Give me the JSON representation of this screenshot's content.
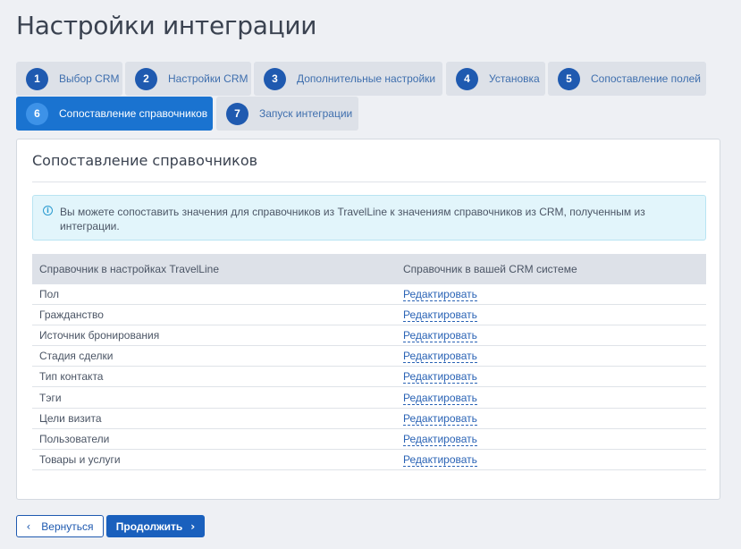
{
  "page": {
    "title": "Настройки интеграции"
  },
  "steps": [
    {
      "num": "1",
      "label": "Выбор CRM",
      "active": false
    },
    {
      "num": "2",
      "label": "Настройки CRM",
      "active": false
    },
    {
      "num": "3",
      "label": "Дополнительные настройки",
      "active": false
    },
    {
      "num": "4",
      "label": "Установка",
      "active": false
    },
    {
      "num": "5",
      "label": "Сопоставление полей",
      "active": false
    },
    {
      "num": "6",
      "label": "Сопоставление справочников",
      "active": true
    },
    {
      "num": "7",
      "label": "Запуск интеграции",
      "active": false
    }
  ],
  "card": {
    "title": "Сопоставление справочников",
    "info_icon": "info-circle-icon",
    "info": "Вы можете сопоставить значения для справочников из TravelLine к значениям справочников из CRM, полученным из интеграции."
  },
  "table": {
    "headers": [
      "Справочник в настройках TravelLine",
      "Справочник в вашей CRM системе"
    ],
    "link_label": "Редактировать",
    "rows": [
      "Пол",
      "Гражданство",
      "Источник бронирования",
      "Стадия сделки",
      "Тип контакта",
      "Тэги",
      "Цели визита",
      "Пользователи",
      "Товары и услуги"
    ]
  },
  "buttons": {
    "back": "Вернуться",
    "next": "Продолжить",
    "back_icon": "chevron-left-icon",
    "next_icon": "chevron-right-icon"
  },
  "colors": {
    "accent": "#1a73d0",
    "step_bg": "#dde1e8",
    "link": "#2a63b5",
    "info_bg": "#e2f5fb"
  }
}
